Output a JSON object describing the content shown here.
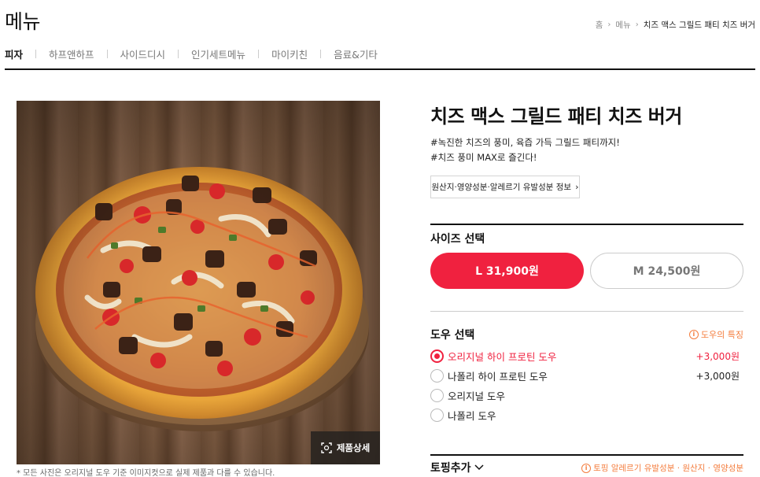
{
  "header": {
    "title": "메뉴",
    "breadcrumb": [
      "홈",
      "메뉴",
      "치즈 맥스 그릴드 패티 치즈 버거"
    ]
  },
  "tabs": [
    {
      "label": "피자",
      "active": true
    },
    {
      "label": "하프앤하프",
      "active": false
    },
    {
      "label": "사이드디시",
      "active": false
    },
    {
      "label": "인기세트메뉴",
      "active": false
    },
    {
      "label": "마이키친",
      "active": false
    },
    {
      "label": "음료&기타",
      "active": false
    }
  ],
  "photo": {
    "detail_button": "제품상세",
    "note": "* 모든 사진은 오리지널 도우 기준 이미지컷으로 실제 제품과 다를 수 있습니다."
  },
  "product": {
    "name": "치즈 맥스 그릴드 패티 치즈 버거",
    "hashtags": [
      "#녹진한 치즈의 풍미, 육즙 가득 그릴드 패티까지!",
      "#치즈 풍미 MAX로 즐긴다!"
    ],
    "info_button": "원산지·영양성분·알레르기 유발성분 정보"
  },
  "size": {
    "title": "사이즈 선택",
    "options": [
      {
        "label": "L 31,900원",
        "selected": true
      },
      {
        "label": "M 24,500원",
        "selected": false
      }
    ]
  },
  "dough": {
    "title": "도우 선택",
    "feature_link": "도우의 특징",
    "options": [
      {
        "label": "오리지널 하이 프로틴 도우",
        "price": "+3,000원",
        "checked": true
      },
      {
        "label": "나폴리 하이 프로틴 도우",
        "price": "+3,000원",
        "checked": false
      },
      {
        "label": "오리지널 도우",
        "price": "",
        "checked": false
      },
      {
        "label": "나폴리 도우",
        "price": "",
        "checked": false
      }
    ]
  },
  "topping": {
    "title": "토핑추가",
    "note": "토핑 알레르기 유발성분 · 원산지 · 영양성분"
  },
  "colors": {
    "accent": "#f0213f",
    "orange": "#f47c3c"
  }
}
